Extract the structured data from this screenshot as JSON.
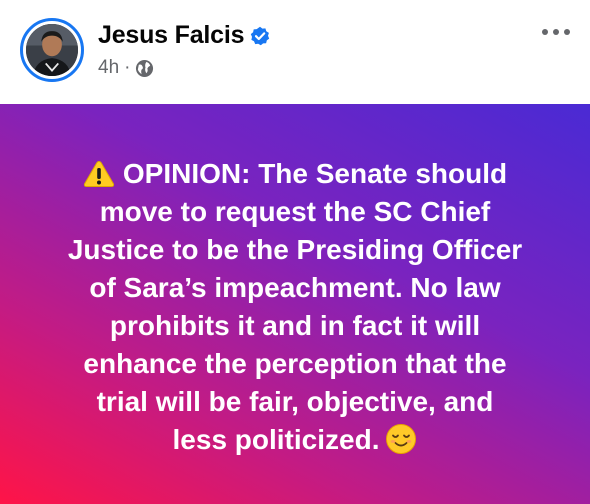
{
  "post": {
    "author_name": "Jesus Falcis",
    "timestamp": "4h",
    "separator": "·",
    "audience_icon": "globe-icon",
    "verified_icon": "verified-badge-icon",
    "more_icon": "more-options-icon",
    "lines": [
      "OPINION: The Senate should",
      "move to request the SC Chief",
      "Justice to be the Presiding Officer",
      "of Sara’s impeachment. No law",
      "prohibits it and in fact it will",
      "enhance the perception that the",
      "trial will be fair, objective, and",
      "less politicized."
    ],
    "lead_icon": "warning-icon",
    "trail_icon": "relieved-face-icon"
  },
  "colors": {
    "verified": "#1877f2",
    "name": "#050505",
    "meta": "#65676b",
    "gradient_top_right": "#4a2ad4",
    "gradient_bottom_left": "#ff1447",
    "text": "#ffffff"
  }
}
